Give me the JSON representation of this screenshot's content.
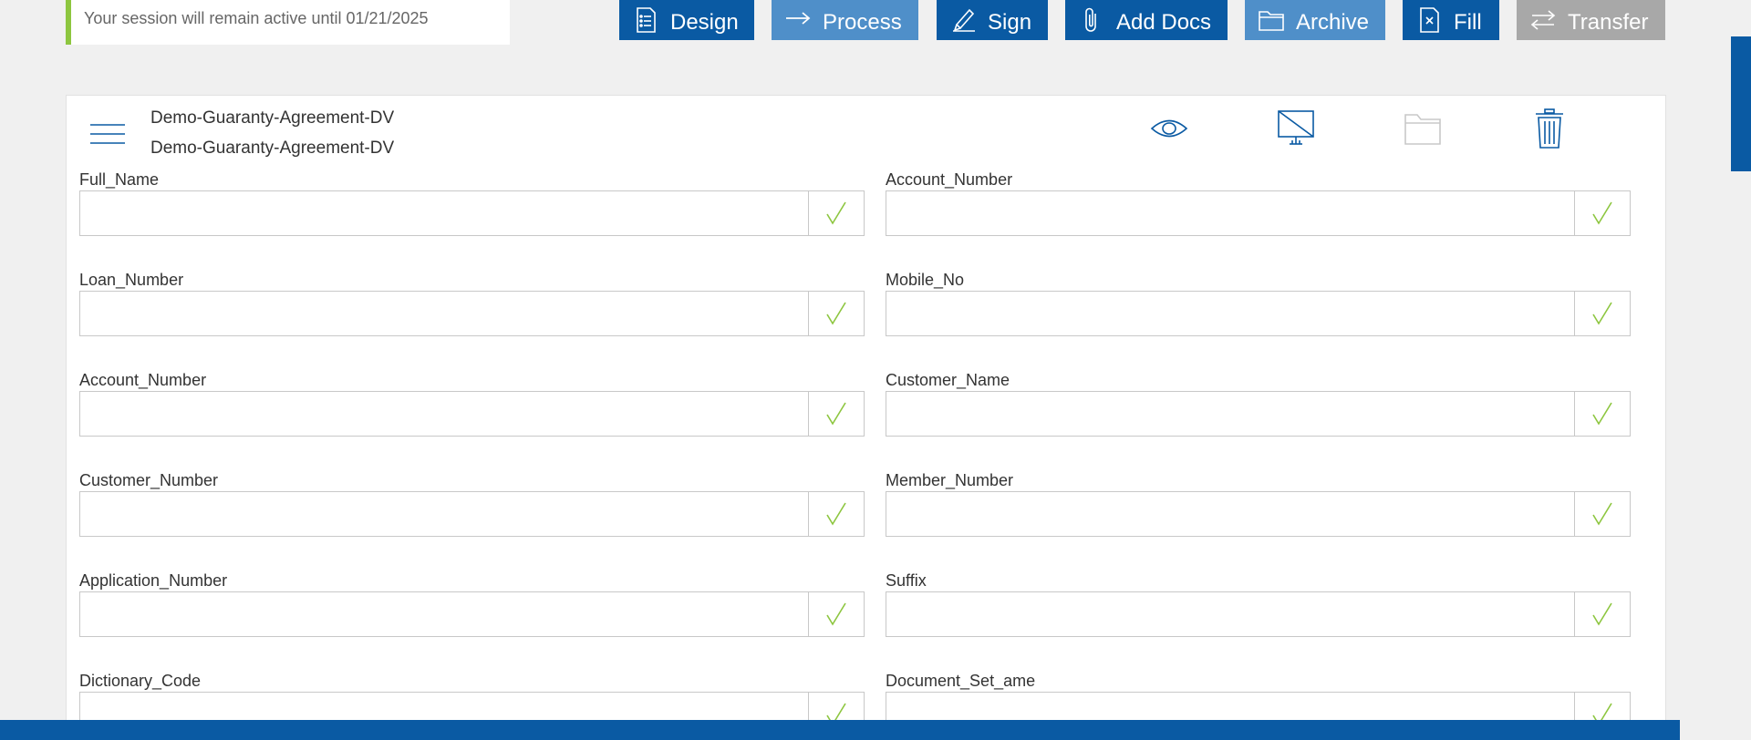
{
  "session": {
    "text": "Your session will remain active until 01/21/2025"
  },
  "toolbar": {
    "buttons": [
      {
        "label": "Design",
        "icon": "checklist-icon"
      },
      {
        "label": "Process",
        "icon": "arrow-right-icon"
      },
      {
        "label": "Sign",
        "icon": "pen-icon"
      },
      {
        "label": "Add Docs",
        "icon": "paperclip-icon"
      },
      {
        "label": "Archive",
        "icon": "folder-icon"
      },
      {
        "label": "Fill",
        "icon": "fill-document-icon"
      },
      {
        "label": "Transfer",
        "icon": "transfer-arrows-icon"
      }
    ]
  },
  "document": {
    "title": "Demo-Guaranty-Agreement-DV",
    "subtitle": "Demo-Guaranty-Agreement-DV"
  },
  "header_icons": [
    "eye-icon",
    "monitor-off-icon",
    "folder-icon",
    "trash-icon"
  ],
  "fields": {
    "left": [
      {
        "label": "Full_Name",
        "value": ""
      },
      {
        "label": "Loan_Number",
        "value": ""
      },
      {
        "label": "Account_Number",
        "value": ""
      },
      {
        "label": "Customer_Number",
        "value": ""
      },
      {
        "label": "Application_Number",
        "value": ""
      },
      {
        "label": "Dictionary_Code",
        "value": ""
      }
    ],
    "right": [
      {
        "label": "Account_Number",
        "value": ""
      },
      {
        "label": "Mobile_No",
        "value": ""
      },
      {
        "label": "Customer_Name",
        "value": ""
      },
      {
        "label": "Member_Number",
        "value": ""
      },
      {
        "label": "Suffix",
        "value": ""
      },
      {
        "label": "Document_Set_ame",
        "value": ""
      }
    ]
  },
  "colors": {
    "primary": "#0a5aa3",
    "primary_light": "#4f8fc9",
    "disabled": "#a8a8a8",
    "valid_check": "#8dc63f"
  }
}
